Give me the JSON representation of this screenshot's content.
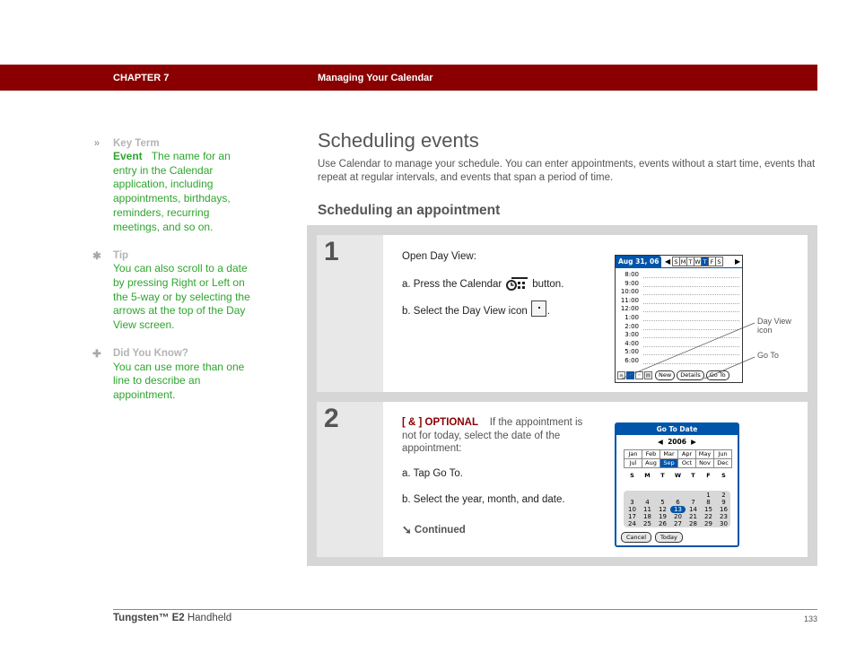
{
  "header": {
    "chapter": "CHAPTER 7",
    "title": "Managing Your Calendar",
    "bar_color": "#8a0000"
  },
  "sidebar": {
    "key_term": {
      "icon": "double-chevron-right-icon",
      "heading": "Key Term",
      "term": "Event",
      "definition": "The name for an entry in the Calendar application, including appointments, birthdays, reminders, recurring meetings, and so on."
    },
    "tip": {
      "icon": "asterisk-icon",
      "heading": "Tip",
      "body": "You can also scroll to a date by pressing Right or Left on the 5-way or by selecting the arrows at the top of the Day View screen."
    },
    "did_you_know": {
      "icon": "plus-icon",
      "heading": "Did You Know?",
      "body": "You can use more than one line to describe an appointment."
    },
    "text_color": "#2ea52e"
  },
  "main": {
    "title": "Scheduling events",
    "intro": "Use Calendar to manage your schedule. You can enter appointments, events without a start time, events that repeat at regular intervals, and events that span a period of time.",
    "subtitle": "Scheduling an appointment",
    "steps": [
      {
        "number": "1",
        "lead": "Open Day View:",
        "a_prefix": "a.  Press the Calendar",
        "a_suffix": "button.",
        "b_prefix": "b.  Select the Day View icon",
        "b_suffix": ".",
        "screen": {
          "date": "Aug 31, 06",
          "weekdays": [
            "S",
            "M",
            "T",
            "W",
            "T",
            "F",
            "S"
          ],
          "selected_weekday_index": 4,
          "times": [
            "8:00",
            "9:00",
            "10:00",
            "11:00",
            "12:00",
            "1:00",
            "2:00",
            "3:00",
            "4:00",
            "5:00",
            "6:00"
          ],
          "buttons": [
            "New",
            "Details",
            "Go To"
          ],
          "callouts": [
            "Day View icon",
            "Go To"
          ]
        }
      },
      {
        "number": "2",
        "optional_tag": "[ & ]  OPTIONAL",
        "lead": "If the appointment is not for today, select the date of the appointment:",
        "a": "a.  Tap Go To.",
        "b": "b.  Select the year, month, and date.",
        "continued": "Continued",
        "screen": {
          "title": "Go To Date",
          "year": "2006",
          "months": [
            "Jan",
            "Feb",
            "Mar",
            "Apr",
            "May",
            "Jun",
            "Jul",
            "Aug",
            "Sep",
            "Oct",
            "Nov",
            "Dec"
          ],
          "selected_month": "Sep",
          "weekdays": [
            "S",
            "M",
            "T",
            "W",
            "T",
            "F",
            "S"
          ],
          "days": [
            "",
            "",
            "",
            "",
            "",
            "1",
            "2",
            "3",
            "4",
            "5",
            "6",
            "7",
            "8",
            "9",
            "10",
            "11",
            "12",
            "13",
            "14",
            "15",
            "16",
            "17",
            "18",
            "19",
            "20",
            "21",
            "22",
            "23",
            "24",
            "25",
            "26",
            "27",
            "28",
            "29",
            "30"
          ],
          "selected_day": "13",
          "buttons": [
            "Cancel",
            "Today"
          ]
        }
      }
    ]
  },
  "footer": {
    "product_brand": "Tungsten™ E2",
    "product_suffix": " Handheld",
    "page_number": "133"
  }
}
